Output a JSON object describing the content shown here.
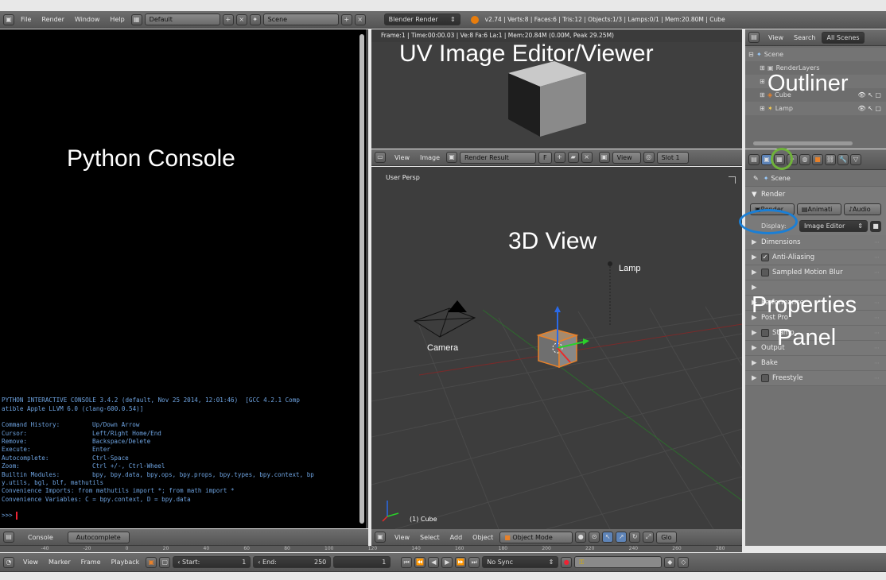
{
  "top_bar": {
    "menus": [
      "File",
      "Render",
      "Window",
      "Help"
    ],
    "layout": "Default",
    "scene": "Scene",
    "engine": "Blender Render",
    "stats": "v2.74 | Verts:8 | Faces:6 | Tris:12 | Objects:1/3 | Lamps:0/1 | Mem:20.80M | Cube"
  },
  "console": {
    "label": "Python Console",
    "banner1": "PYTHON INTERACTIVE CONSOLE 3.4.2 (default, Nov 25 2014, 12:01:46)  [GCC 4.2.1 Comp",
    "banner2": "atible Apple LLVM 6.0 (clang-600.0.54)]",
    "help": [
      {
        "key": "Command History:",
        "val": "Up/Down Arrow"
      },
      {
        "key": "Cursor:",
        "val": "Left/Right Home/End"
      },
      {
        "key": "Remove:",
        "val": "Backspace/Delete"
      },
      {
        "key": "Execute:",
        "val": "Enter"
      },
      {
        "key": "Autocomplete:",
        "val": "Ctrl-Space"
      },
      {
        "key": "Zoom:",
        "val": "Ctrl +/-, Ctrl-Wheel"
      },
      {
        "key": "Builtin Modules:",
        "val": "bpy, bpy.data, bpy.ops, bpy.props, bpy.types, bpy.context, bp"
      }
    ],
    "modules_cont": "y.utils, bgl, blf, mathutils",
    "imports": "Convenience Imports: from mathutils import *; from math import *",
    "variables": "Convenience Variables: C = bpy.context, D = bpy.data",
    "prompt": ">>> ",
    "tabs": [
      "Console",
      "Autocomplete"
    ]
  },
  "uv_editor": {
    "label": "UV Image Editor/Viewer",
    "info": "Frame:1 | Time:00:00.03 | Ve:8 Fa:6 La:1 | Mem:20.84M (0.00M, Peak 29.25M)",
    "menus": [
      "View",
      "Image"
    ],
    "image": "Render Result",
    "fake": "F",
    "view": "View",
    "slot": "Slot 1"
  },
  "viewport": {
    "label": "3D View",
    "persp": "User Persp",
    "lamp": "Lamp",
    "camera": "Camera",
    "object": "(1) Cube",
    "menus": [
      "View",
      "Select",
      "Add",
      "Object"
    ],
    "mode": "Object Mode",
    "global": "Glo"
  },
  "outliner": {
    "label": "Outliner",
    "menus": [
      "View",
      "Search"
    ],
    "filter": "All Scenes",
    "items": [
      "Scene",
      "RenderLayers",
      "Cube",
      "Lamp"
    ]
  },
  "properties": {
    "label_line1": "Properties",
    "label_line2": "Panel",
    "breadcrumb": "Scene",
    "render_header": "Render",
    "buttons": [
      "Render",
      "Animati",
      "Audio"
    ],
    "display_label": "Display:",
    "display_value": "Image Editor",
    "panels": [
      "Dimensions",
      "Anti-Aliasing",
      "Sampled Motion Blur",
      "Performance",
      "Post Pro",
      "Stamp",
      "Output",
      "Bake",
      "Freestyle"
    ]
  },
  "timeline": {
    "menus": [
      "View",
      "Marker",
      "Frame",
      "Playback"
    ],
    "start": "Start:",
    "start_val": "1",
    "end": "End:",
    "end_val": "250",
    "current": "1",
    "sync": "No Sync",
    "ruler": [
      "-40",
      "-20",
      "0",
      "20",
      "40",
      "60",
      "80",
      "100",
      "120",
      "140",
      "160",
      "180",
      "200",
      "220",
      "240",
      "260",
      "280"
    ]
  },
  "colors": {
    "highlight_blue": "#1a7fd6",
    "highlight_green": "#6fb23a",
    "console_text": "#6ea3e0"
  }
}
